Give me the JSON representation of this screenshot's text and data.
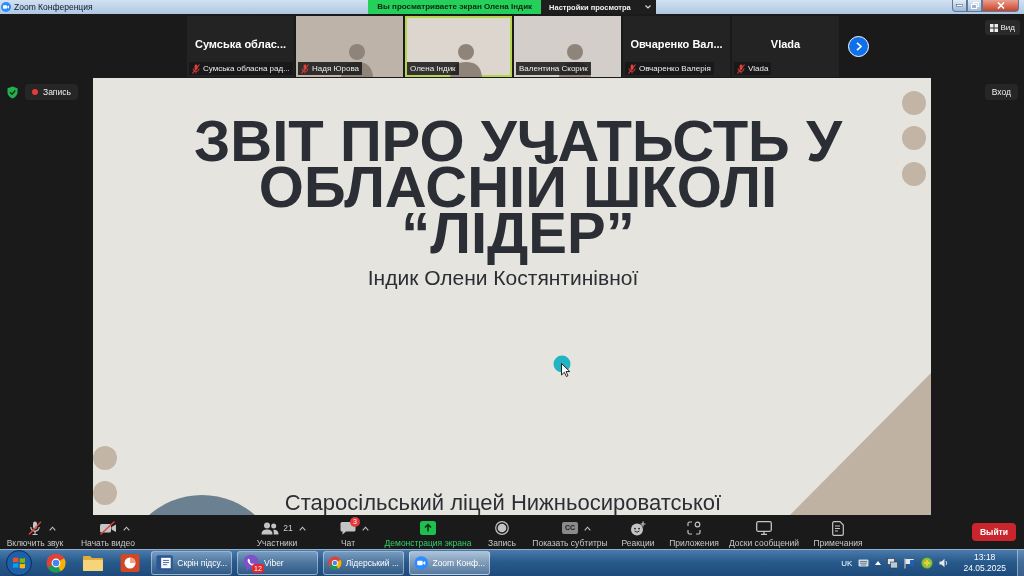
{
  "window": {
    "title": "Zoom Конференция",
    "share_banner": "Вы просматриваете экран Олена Індик",
    "view_options": "Настройки просмотра"
  },
  "gallery": {
    "tiles": [
      {
        "kind": "name",
        "display_name": "Сумська облас...",
        "label": "Сумська обласна рад...",
        "muted": true,
        "speaking": false
      },
      {
        "kind": "video",
        "label": "Надя Юрова",
        "muted": true,
        "speaking": false
      },
      {
        "kind": "video",
        "label": "Олена Індик",
        "muted": false,
        "speaking": true
      },
      {
        "kind": "video",
        "label": "Валентина Скорик",
        "muted": false,
        "speaking": false
      },
      {
        "kind": "name",
        "display_name": "Овчаренко Вал...",
        "label": "Овчаренко Валерія",
        "muted": true,
        "speaking": false
      },
      {
        "kind": "name",
        "display_name": "Vlada",
        "label": "Vlada",
        "muted": true,
        "speaking": false
      }
    ],
    "view_button": "Вид"
  },
  "meeting": {
    "recording": "Запись",
    "enter_button": "Вход"
  },
  "slide": {
    "title": "ЗВІТ ПРО УЧАТЬСТЬ У ОБЛАСНІЙ ШКОЛІ “ЛІДЕР”",
    "subtitle": "Індик Олени Костянтинівної",
    "footer": "Старосільський ліцей Нижньосироватської"
  },
  "toolbar": {
    "items": [
      {
        "kind": "mic-off",
        "label": "Включить звук",
        "menu": true
      },
      {
        "kind": "video-off",
        "label": "Начать видео",
        "menu": true
      },
      {
        "kind": "participants",
        "label": "Участники",
        "count": "21",
        "menu": true
      },
      {
        "kind": "chat",
        "label": "Чат",
        "badge": "3",
        "menu": true
      },
      {
        "kind": "share",
        "label": "Демонстрация экрана",
        "menu": false
      },
      {
        "kind": "record",
        "label": "Запись",
        "menu": false
      },
      {
        "kind": "captions",
        "label": "Показать субтитры",
        "icon_text": "CC",
        "menu": true
      },
      {
        "kind": "reactions",
        "label": "Реакции",
        "menu": false
      },
      {
        "kind": "apps",
        "label": "Приложения",
        "menu": false
      },
      {
        "kind": "whiteboards",
        "label": "Доски сообщений",
        "menu": false
      },
      {
        "kind": "notes",
        "label": "Примечания",
        "menu": false
      }
    ],
    "leave_button": "Выйти"
  },
  "taskbar": {
    "windows": [
      {
        "kind": "word",
        "label": "Скрін підсу...",
        "selected": false
      },
      {
        "kind": "viber",
        "label": "Viber",
        "badge": "12",
        "selected": false
      },
      {
        "kind": "chrome",
        "label": "Лідерський ...",
        "selected": false
      },
      {
        "kind": "zoom",
        "label": "Zoom Конф...",
        "selected": true
      }
    ],
    "tray": {
      "language": "UK",
      "time": "13:18",
      "date": "24.05.2025"
    }
  }
}
